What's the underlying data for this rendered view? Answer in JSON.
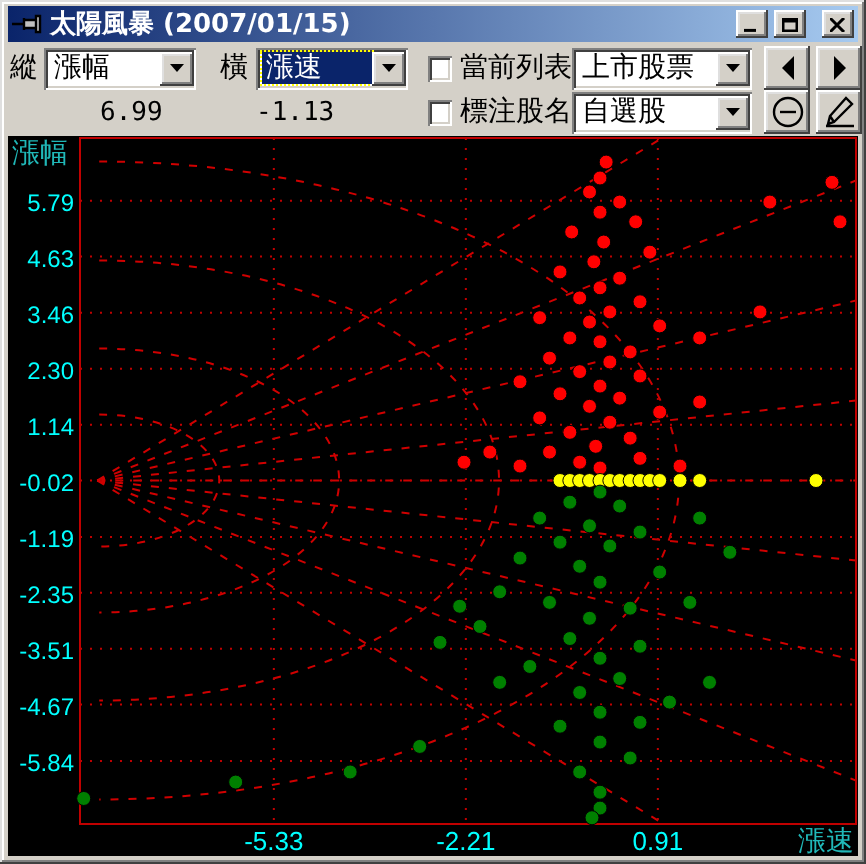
{
  "window": {
    "title": "太陽風暴 (2007/01/15)"
  },
  "toolbar": {
    "vertical": {
      "label": "縱",
      "value": "漲幅",
      "focused": false,
      "reading": "6.99"
    },
    "horizontal": {
      "label": "橫",
      "value": "漲速",
      "focused": true,
      "reading": "-1.13"
    },
    "options": [
      {
        "label": "當前列表",
        "checked": false,
        "value": "上市股票"
      },
      {
        "label": "標注股名",
        "checked": false,
        "value": "自選股"
      }
    ]
  },
  "chart": {
    "chart_data": {
      "type": "scatter",
      "grid": true,
      "xlabel": "漲速",
      "ylabel": "漲幅",
      "xlim": [
        -8.48,
        4.13
      ],
      "ylim": [
        -7.15,
        7.09
      ],
      "xticks": [
        {
          "value": -5.33,
          "label": "-5.33"
        },
        {
          "value": -2.21,
          "label": "-2.21"
        },
        {
          "value": 0.91,
          "label": "0.91"
        }
      ],
      "yticks": [
        {
          "value": 5.79,
          "label": "5.79"
        },
        {
          "value": 4.63,
          "label": "4.63"
        },
        {
          "value": 3.46,
          "label": "3.46"
        },
        {
          "value": 2.3,
          "label": "2.30"
        },
        {
          "value": 1.14,
          "label": "1.14"
        },
        {
          "value": -0.02,
          "label": "-0.02"
        },
        {
          "value": -1.19,
          "label": "-1.19"
        },
        {
          "value": -2.35,
          "label": "-2.35"
        },
        {
          "value": -3.51,
          "label": "-3.51"
        },
        {
          "value": -4.67,
          "label": "-4.67"
        },
        {
          "value": -5.84,
          "label": "-5.84"
        }
      ],
      "series": [
        {
          "color": "#ff0000",
          "x": [
            0.07,
            -0.03,
            -0.2,
            0.29,
            -0.03,
            0.55,
            -0.49,
            0.03,
            0.78,
            -0.13,
            -0.68,
            0.29,
            -0.03,
            -0.36,
            0.62,
            0.13,
            -1.01,
            -0.2,
            0.94,
            -0.52,
            -0.03,
            0.46,
            -0.85,
            0.13,
            -0.36,
            0.62,
            -1.33,
            -0.03,
            -0.68,
            0.29,
            -0.2,
            0.94,
            -1.01,
            0.13,
            -0.52,
            0.46,
            -0.1,
            -0.85,
            0.62,
            -0.36,
            1.27,
            -1.33,
            -0.03,
            -1.82,
            3.87,
            3.74,
            2.73,
            2.57,
            1.59,
            1.59,
            -2.24
          ],
          "values": [
            6.59,
            6.26,
            5.97,
            5.76,
            5.55,
            5.35,
            5.14,
            4.93,
            4.72,
            4.52,
            4.31,
            4.18,
            3.98,
            3.77,
            3.69,
            3.48,
            3.36,
            3.27,
            3.19,
            2.94,
            2.86,
            2.65,
            2.52,
            2.44,
            2.24,
            2.15,
            2.03,
            1.94,
            1.78,
            1.69,
            1.52,
            1.4,
            1.28,
            1.19,
            0.98,
            0.86,
            0.69,
            0.57,
            0.44,
            0.36,
            0.28,
            0.28,
            0.24,
            0.57,
            5.35,
            6.17,
            5.76,
            3.48,
            2.94,
            1.61,
            0.36
          ]
        },
        {
          "color": "#ffff00",
          "x": [
            -0.68,
            -0.52,
            -0.36,
            -0.2,
            -0.03,
            0.13,
            0.29,
            0.46,
            0.62,
            0.78,
            0.94,
            1.27,
            1.59,
            3.48
          ],
          "values": [
            -0.02,
            -0.02,
            -0.02,
            -0.02,
            -0.02,
            -0.02,
            -0.02,
            -0.02,
            -0.02,
            -0.02,
            -0.02,
            -0.02,
            -0.02,
            -0.02
          ]
        },
        {
          "color": "#008000",
          "x": [
            -0.03,
            -0.52,
            0.29,
            -1.01,
            -0.2,
            0.62,
            -0.68,
            0.13,
            -1.33,
            -0.36,
            0.94,
            -0.03,
            -1.66,
            -0.85,
            0.46,
            -0.2,
            -1.98,
            -0.52,
            0.62,
            -0.03,
            -1.17,
            0.29,
            -0.36,
            1.1,
            -0.03,
            -0.68,
            -2.31,
            -0.03,
            0.46,
            -0.36,
            -0.03,
            -0.03,
            -0.16,
            -2.96,
            -4.09,
            -5.95,
            -8.42,
            0.62,
            1.75,
            1.43,
            -1.66,
            -2.63,
            1.59,
            2.08
          ],
          "values": [
            -0.26,
            -0.47,
            -0.55,
            -0.8,
            -0.96,
            -1.09,
            -1.3,
            -1.38,
            -1.63,
            -1.8,
            -1.92,
            -2.13,
            -2.33,
            -2.55,
            -2.67,
            -2.88,
            -3.05,
            -3.3,
            -3.46,
            -3.71,
            -3.88,
            -4.13,
            -4.42,
            -4.62,
            -4.83,
            -5.12,
            -2.63,
            -5.45,
            -5.78,
            -6.07,
            -6.49,
            -6.82,
            -7.02,
            -5.54,
            -6.07,
            -6.28,
            -6.62,
            -5.04,
            -4.21,
            -2.55,
            -4.21,
            -3.38,
            -0.8,
            -1.51
          ]
        }
      ]
    }
  }
}
